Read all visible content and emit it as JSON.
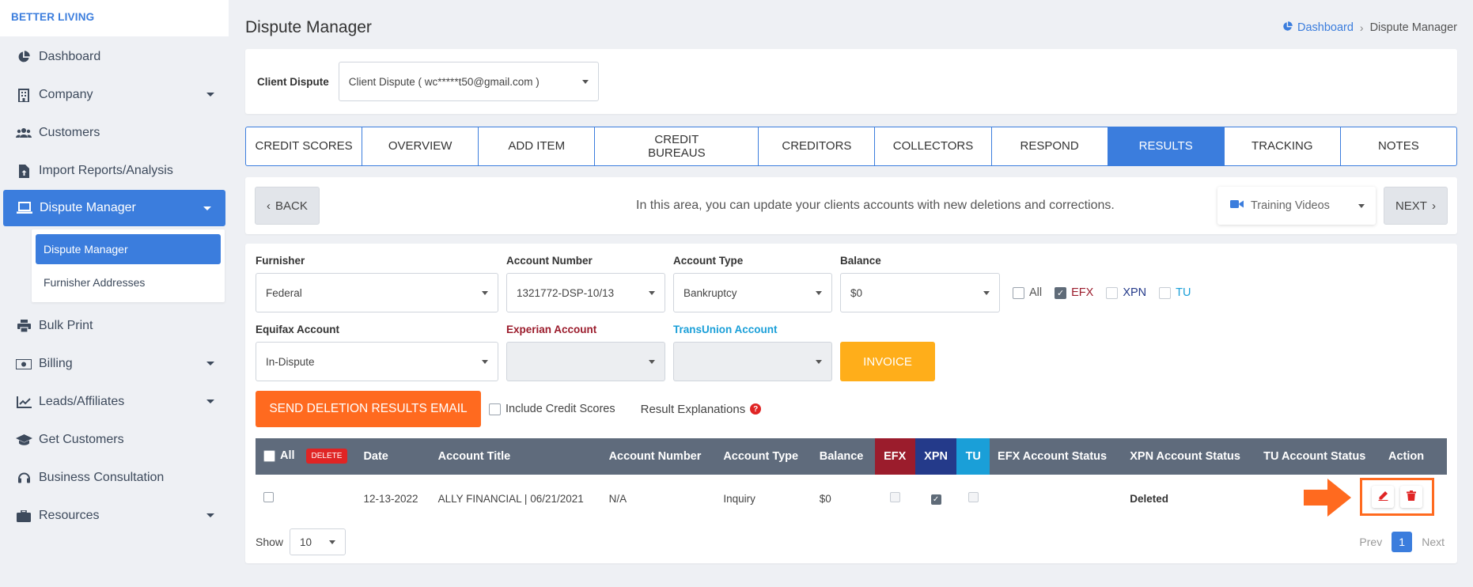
{
  "brand": "BETTER LIVING",
  "sidebar": {
    "items": [
      {
        "label": "Dashboard",
        "icon": "pie-chart-icon"
      },
      {
        "label": "Company",
        "icon": "building-icon",
        "caret": true
      },
      {
        "label": "Customers",
        "icon": "users-icon"
      },
      {
        "label": "Import Reports/Analysis",
        "icon": "file-upload-icon"
      },
      {
        "label": "Dispute Manager",
        "icon": "laptop-icon",
        "caret": true,
        "active": true
      },
      {
        "label": "Bulk Print",
        "icon": "printer-icon"
      },
      {
        "label": "Billing",
        "icon": "money-icon",
        "caret": true
      },
      {
        "label": "Leads/Affiliates",
        "icon": "chart-line-icon",
        "caret": true
      },
      {
        "label": "Get Customers",
        "icon": "graduation-cap-icon"
      },
      {
        "label": "Business Consultation",
        "icon": "headset-icon"
      },
      {
        "label": "Resources",
        "icon": "briefcase-icon",
        "caret": true
      }
    ],
    "submenu": [
      "Dispute Manager",
      "Furnisher Addresses"
    ]
  },
  "header": {
    "title": "Dispute Manager",
    "breadcrumb_home": "Dashboard",
    "breadcrumb_current": "Dispute Manager"
  },
  "client": {
    "label": "Client Dispute",
    "value": "Client Dispute ( wc*****t50@gmail.com )"
  },
  "tabs": [
    {
      "label": "CREDIT SCORES"
    },
    {
      "label": "OVERVIEW"
    },
    {
      "label": "ADD ITEM"
    },
    {
      "label": "CREDIT BUREAUS"
    },
    {
      "label": "CREDITORS"
    },
    {
      "label": "COLLECTORS"
    },
    {
      "label": "RESPOND"
    },
    {
      "label": "RESULTS",
      "active": true
    },
    {
      "label": "TRACKING"
    },
    {
      "label": "NOTES"
    }
  ],
  "action_bar": {
    "back": "BACK",
    "info": "In this area, you can update your clients accounts with new deletions and corrections.",
    "training": "Training Videos",
    "next": "NEXT"
  },
  "filters": {
    "furnisher_label": "Furnisher",
    "furnisher_value": "Federal",
    "account_number_label": "Account Number",
    "account_number_value": "1321772-DSP-10/13",
    "account_type_label": "Account Type",
    "account_type_value": "Bankruptcy",
    "balance_label": "Balance",
    "balance_value": "$0",
    "check_all": "All",
    "check_efx": "EFX",
    "check_xpn": "XPN",
    "check_tu": "TU",
    "equifax_label": "Equifax Account",
    "equifax_value": "In-Dispute",
    "experian_label": "Experian Account",
    "transunion_label": "TransUnion Account",
    "invoice": "INVOICE"
  },
  "email_row": {
    "send_button": "SEND DELETION RESULTS EMAIL",
    "include_scores": "Include Credit Scores",
    "result_explanations": "Result Explanations"
  },
  "table": {
    "headers": {
      "all": "All",
      "delete": "DELETE",
      "date": "Date",
      "account_title": "Account Title",
      "account_number": "Account Number",
      "account_type": "Account Type",
      "balance": "Balance",
      "efx": "EFX",
      "xpn": "XPN",
      "tu": "TU",
      "efx_status": "EFX Account Status",
      "xpn_status": "XPN Account Status",
      "tu_status": "TU Account Status",
      "action": "Action"
    },
    "rows": [
      {
        "date": "12-13-2022",
        "account_title": "ALLY FINANCIAL | 06/21/2021",
        "account_number": "N/A",
        "account_type": "Inquiry",
        "balance": "$0",
        "efx_checked": false,
        "xpn_checked": true,
        "tu_checked": false,
        "efx_status": "",
        "xpn_status": "Deleted",
        "tu_status": ""
      }
    ]
  },
  "pager": {
    "show_label": "Show",
    "per_page": "10",
    "prev": "Prev",
    "page": "1",
    "next": "Next"
  },
  "colors": {
    "primary": "#3b7ddd",
    "orange": "#ff6a1f",
    "invoice": "#ffae1a",
    "efx": "#9b1c2c",
    "xpn": "#243a8a",
    "tu": "#1a9fd8",
    "danger": "#e02424"
  }
}
